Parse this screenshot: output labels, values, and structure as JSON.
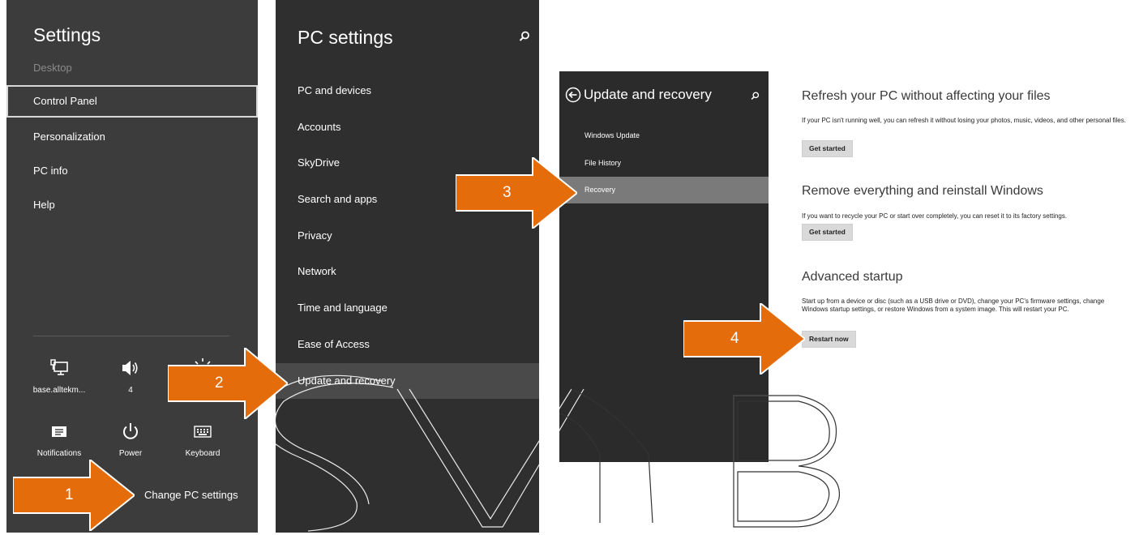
{
  "settings_charm": {
    "title": "Settings",
    "subtitle": "Desktop",
    "items": [
      {
        "label": "Control Panel"
      },
      {
        "label": "Personalization"
      },
      {
        "label": "PC info"
      },
      {
        "label": "Help"
      }
    ],
    "tiles": [
      {
        "label": "base.alltekm...",
        "icon": "network-icon"
      },
      {
        "label": "4",
        "icon": "volume-icon"
      },
      {
        "label": "",
        "icon": "brightness-icon"
      },
      {
        "label": "Notifications",
        "icon": "notifications-icon"
      },
      {
        "label": "Power",
        "icon": "power-icon"
      },
      {
        "label": "Keyboard",
        "icon": "keyboard-icon"
      }
    ],
    "change_link": "Change PC settings"
  },
  "pc_settings": {
    "title": "PC settings",
    "items": [
      {
        "label": "PC and devices"
      },
      {
        "label": "Accounts"
      },
      {
        "label": "SkyDrive"
      },
      {
        "label": "Search and apps"
      },
      {
        "label": "Privacy"
      },
      {
        "label": "Network"
      },
      {
        "label": "Time and language"
      },
      {
        "label": "Ease of Access"
      },
      {
        "label": "Update and recovery"
      }
    ],
    "selected": "Update and recovery"
  },
  "update_recovery": {
    "title": "Update and recovery",
    "items": [
      {
        "label": "Windows Update"
      },
      {
        "label": "File History"
      },
      {
        "label": "Recovery"
      }
    ],
    "selected": "Recovery"
  },
  "recovery": {
    "refresh": {
      "title": "Refresh your PC without affecting your files",
      "desc": "If your PC isn't running well, you can refresh it without losing your photos, music, videos, and other personal files.",
      "button": "Get started"
    },
    "reset": {
      "title": "Remove everything and reinstall Windows",
      "desc": "If you want to recycle your PC or start over completely, you can reset it to its factory settings.",
      "button": "Get started"
    },
    "advanced": {
      "title": "Advanced startup",
      "desc": "Start up from a device or disc (such as a USB drive or DVD), change your PC's firmware settings, change Windows startup settings, or restore Windows from a system image. This will restart your PC.",
      "button": "Restart now"
    }
  },
  "steps": [
    "1",
    "2",
    "3",
    "4"
  ],
  "colors": {
    "arrow": "#e46c0a",
    "panel_dark": "#2f2f2f",
    "panel_mid": "#3c3c3c",
    "selected_gray": "#7a7a7a"
  }
}
